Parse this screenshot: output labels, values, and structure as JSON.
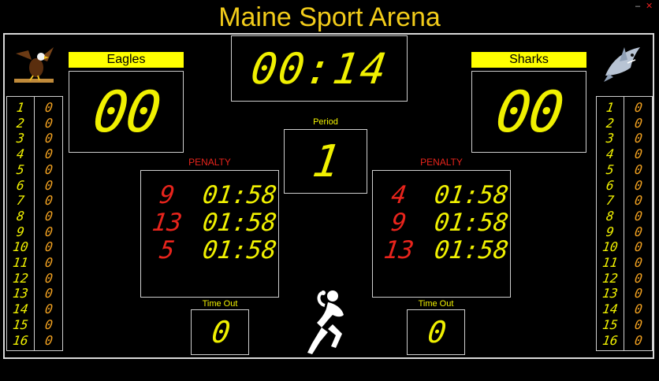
{
  "arena_title": "Maine Sport Arena",
  "window_controls": {
    "minimize": "–",
    "close": "✕"
  },
  "clock": "00:14",
  "period": {
    "label": "Period",
    "value": "1"
  },
  "penalty_label": "PENALTY",
  "timeout_label": "Time Out",
  "home": {
    "name": "Eagles",
    "logo_icon": "eagle-icon",
    "score": "00",
    "timeouts": "0",
    "penalties": [
      {
        "player": "9",
        "time": "01:58"
      },
      {
        "player": "13",
        "time": "01:58"
      },
      {
        "player": "5",
        "time": "01:58"
      }
    ],
    "roster": [
      {
        "player": "1",
        "points": "0"
      },
      {
        "player": "2",
        "points": "0"
      },
      {
        "player": "3",
        "points": "0"
      },
      {
        "player": "4",
        "points": "0"
      },
      {
        "player": "5",
        "points": "0"
      },
      {
        "player": "6",
        "points": "0"
      },
      {
        "player": "7",
        "points": "0"
      },
      {
        "player": "8",
        "points": "0"
      },
      {
        "player": "9",
        "points": "0"
      },
      {
        "player": "10",
        "points": "0"
      },
      {
        "player": "11",
        "points": "0"
      },
      {
        "player": "12",
        "points": "0"
      },
      {
        "player": "13",
        "points": "0"
      },
      {
        "player": "14",
        "points": "0"
      },
      {
        "player": "15",
        "points": "0"
      },
      {
        "player": "16",
        "points": "0"
      }
    ]
  },
  "away": {
    "name": "Sharks",
    "logo_icon": "shark-icon",
    "score": "00",
    "timeouts": "0",
    "penalties": [
      {
        "player": "4",
        "time": "01:58"
      },
      {
        "player": "9",
        "time": "01:58"
      },
      {
        "player": "13",
        "time": "01:58"
      }
    ],
    "roster": [
      {
        "player": "1",
        "points": "0"
      },
      {
        "player": "2",
        "points": "0"
      },
      {
        "player": "3",
        "points": "0"
      },
      {
        "player": "4",
        "points": "0"
      },
      {
        "player": "5",
        "points": "0"
      },
      {
        "player": "6",
        "points": "0"
      },
      {
        "player": "7",
        "points": "0"
      },
      {
        "player": "8",
        "points": "0"
      },
      {
        "player": "9",
        "points": "0"
      },
      {
        "player": "10",
        "points": "0"
      },
      {
        "player": "11",
        "points": "0"
      },
      {
        "player": "12",
        "points": "0"
      },
      {
        "player": "13",
        "points": "0"
      },
      {
        "player": "14",
        "points": "0"
      },
      {
        "player": "15",
        "points": "0"
      },
      {
        "player": "16",
        "points": "0"
      }
    ]
  },
  "sport_icon": "handball-player-icon",
  "colors": {
    "title": "#f2cc1a",
    "digits": "#f0f000",
    "penalty": "#e8241c",
    "roster_points": "#f0a020",
    "label_bg": "#ffff00"
  }
}
